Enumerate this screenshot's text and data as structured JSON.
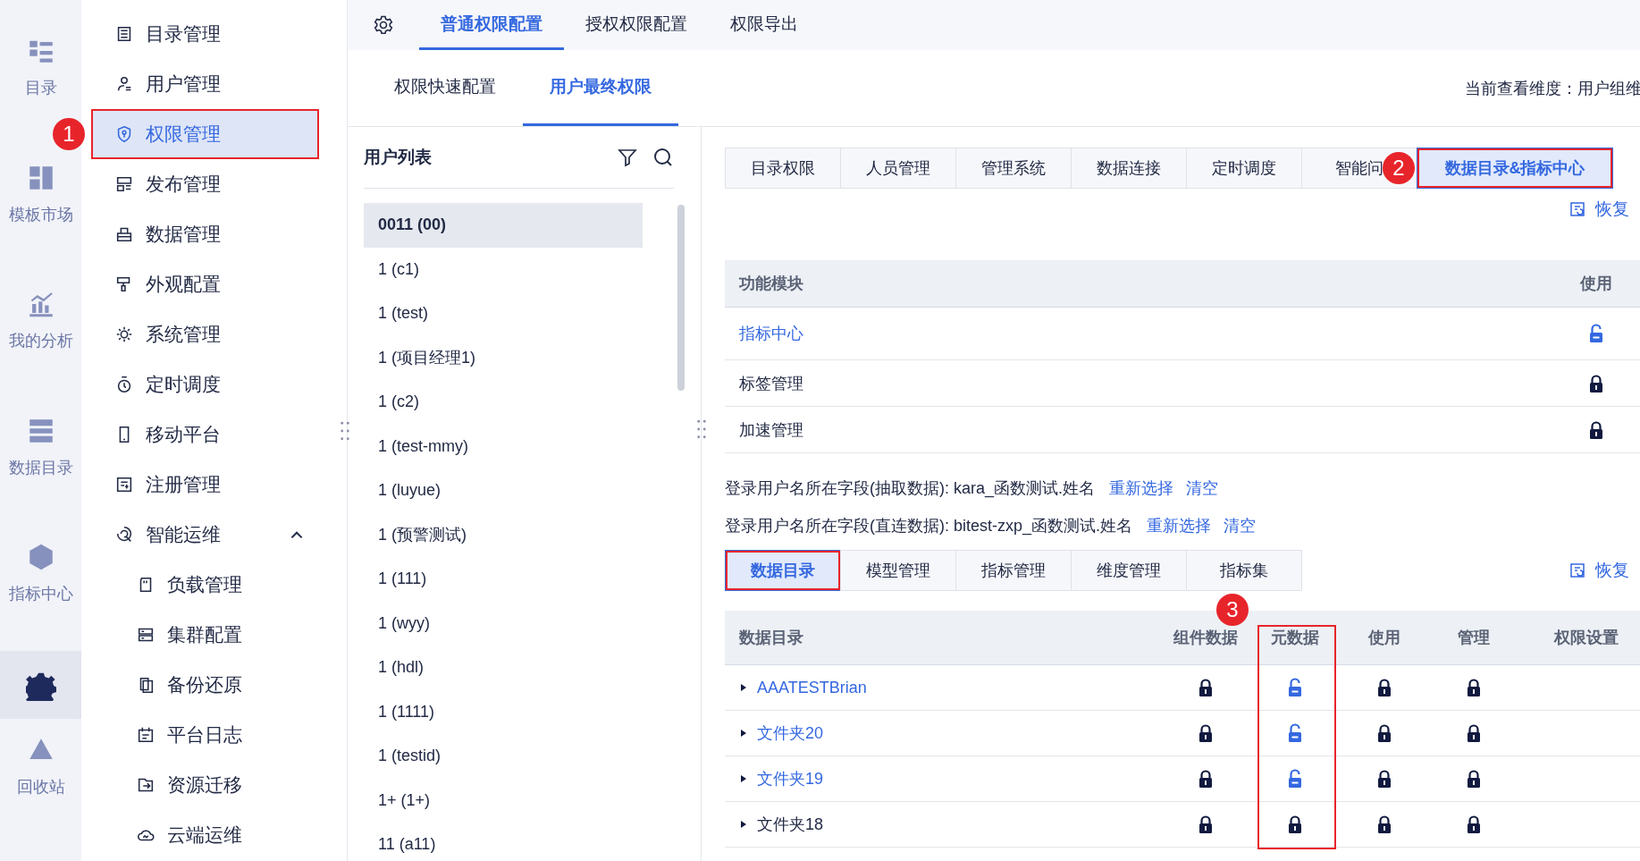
{
  "rail": {
    "items": [
      {
        "label": "目录",
        "selected": false
      },
      {
        "label": "模板市场",
        "selected": false
      },
      {
        "label": "我的分析",
        "selected": false
      },
      {
        "label": "数据目录",
        "selected": false
      },
      {
        "label": "指标中心",
        "selected": false
      },
      {
        "selected": true
      },
      {
        "label": "回收站",
        "selected": false
      }
    ]
  },
  "nav": {
    "items": [
      {
        "label": "目录管理",
        "selected": false
      },
      {
        "label": "用户管理",
        "selected": false
      },
      {
        "label": "权限管理",
        "selected": true,
        "badge": "1"
      },
      {
        "label": "发布管理",
        "selected": false
      },
      {
        "label": "数据管理",
        "selected": false
      },
      {
        "label": "外观配置",
        "selected": false
      },
      {
        "label": "系统管理",
        "selected": false
      },
      {
        "label": "定时调度",
        "selected": false
      },
      {
        "label": "移动平台",
        "selected": false
      },
      {
        "label": "注册管理",
        "selected": false
      },
      {
        "label": "智能运维",
        "selected": false,
        "expanded": true,
        "children": [
          {
            "label": "负载管理",
            "selected": false
          },
          {
            "label": "集群配置",
            "selected": false
          },
          {
            "label": "备份还原",
            "selected": false
          },
          {
            "label": "平台日志",
            "selected": false
          },
          {
            "label": "资源迁移",
            "selected": false
          },
          {
            "label": "云端运维",
            "selected": false
          }
        ]
      }
    ]
  },
  "top_tabs": [
    {
      "label": "普通权限配置",
      "selected": true
    },
    {
      "label": "授权权限配置",
      "selected": false
    },
    {
      "label": "权限导出",
      "selected": false
    }
  ],
  "sub_tabs": [
    {
      "label": "权限快速配置",
      "selected": false
    },
    {
      "label": "用户最终权限",
      "selected": true
    }
  ],
  "dimension": "当前查看维度：用户组维",
  "user_list": {
    "title": "用户列表",
    "items": [
      {
        "label": "0011 (00)",
        "selected": true
      },
      {
        "label": "1 (c1)",
        "selected": false
      },
      {
        "label": "1 (test)",
        "selected": false
      },
      {
        "label": "1 (项目经理1)",
        "selected": false
      },
      {
        "label": "1 (c2)",
        "selected": false
      },
      {
        "label": "1 (test-mmy)",
        "selected": false
      },
      {
        "label": "1 (luyue)",
        "selected": false
      },
      {
        "label": "1 (预警测试)",
        "selected": false
      },
      {
        "label": "1 (111)",
        "selected": false
      },
      {
        "label": "1 (wyy)",
        "selected": false
      },
      {
        "label": "1 (hdl)",
        "selected": false
      },
      {
        "label": "1 (1111)",
        "selected": false
      },
      {
        "label": "1 (testid)",
        "selected": false
      },
      {
        "label": "1+ (1+)",
        "selected": false
      },
      {
        "label": "11 (a11)",
        "selected": false
      }
    ]
  },
  "module_tabs": [
    {
      "label": "目录权限",
      "selected": false
    },
    {
      "label": "人员管理",
      "selected": false
    },
    {
      "label": "管理系统",
      "selected": false
    },
    {
      "label": "数据连接",
      "selected": false
    },
    {
      "label": "定时调度",
      "selected": false
    },
    {
      "label": "智能问",
      "selected": false
    },
    {
      "label": "数据目录&指标中心",
      "selected": true,
      "badge": "2"
    }
  ],
  "function_section": {
    "restore": "恢复",
    "columns": [
      "功能模块",
      "使用"
    ],
    "rows": [
      {
        "name": "指标中心",
        "link": true,
        "locked": false
      },
      {
        "name": "标签管理",
        "link": false,
        "locked": true
      },
      {
        "name": "加速管理",
        "link": false,
        "locked": true
      }
    ]
  },
  "login_fields": [
    {
      "text": "登录用户名所在字段(抽取数据): kara_函数测试.姓名",
      "actions": [
        "重新选择",
        "清空"
      ]
    },
    {
      "text": "登录用户名所在字段(直连数据): bitest-zxp_函数测试.姓名",
      "actions": [
        "重新选择",
        "清空"
      ]
    }
  ],
  "catalog_tabs": [
    {
      "label": "数据目录",
      "selected": true
    },
    {
      "label": "模型管理",
      "selected": false
    },
    {
      "label": "指标管理",
      "selected": false
    },
    {
      "label": "维度管理",
      "selected": false
    },
    {
      "label": "指标集",
      "selected": false
    }
  ],
  "catalog_section": {
    "restore": "恢复",
    "columns": [
      {
        "label": "数据目录"
      },
      {
        "label": "组件数据"
      },
      {
        "label": "元数据",
        "badge": "3"
      },
      {
        "label": "使用"
      },
      {
        "label": "管理"
      },
      {
        "label": "权限设置"
      }
    ],
    "rows": [
      {
        "name": "AAATESTBrian",
        "link": true,
        "cells": [
          {
            "locked": true
          },
          {
            "locked": false
          },
          {
            "locked": true
          },
          {
            "locked": true
          }
        ]
      },
      {
        "name": "文件夹20",
        "link": true,
        "cells": [
          {
            "locked": true
          },
          {
            "locked": false
          },
          {
            "locked": true
          },
          {
            "locked": true
          }
        ]
      },
      {
        "name": "文件夹19",
        "link": true,
        "cells": [
          {
            "locked": true
          },
          {
            "locked": false
          },
          {
            "locked": true
          },
          {
            "locked": true
          }
        ]
      },
      {
        "name": "文件夹18",
        "link": false,
        "cells": [
          {
            "locked": true
          },
          {
            "locked": true
          },
          {
            "locked": true
          },
          {
            "locked": true
          }
        ]
      }
    ]
  }
}
